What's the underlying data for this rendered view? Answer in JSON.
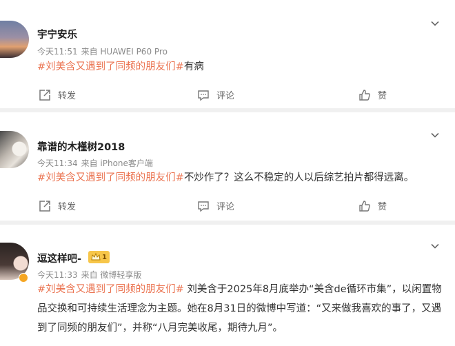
{
  "posts": [
    {
      "username": "宇宁安乐",
      "time": "今天11:51",
      "source": "来自 HUAWEI P60 Pro",
      "hashtag": "#刘美含又遇到了同频的朋友们#",
      "text": "有病",
      "actions": {
        "repost": "转发",
        "comment": "评论",
        "like": "赞"
      }
    },
    {
      "username": "靠谱的木槿树2018",
      "time": "今天11:34",
      "source": "来自 iPhone客户端",
      "hashtag": "#刘美含又遇到了同频的朋友们#",
      "text": "不炒作了？这么不稳定的人以后综艺拍片都得远离。",
      "actions": {
        "repost": "转发",
        "comment": "评论",
        "like": "赞"
      }
    },
    {
      "username": "逗这样吧-",
      "badge": "1",
      "time": "今天11:33",
      "source": "来自 微博轻享版",
      "hashtag": "#刘美含又遇到了同频的朋友们#",
      "text": " 刘美含于2025年8月底举办“美含de循环市集”，以闲置物品交换和可持续生活理念为主题。她在8月31日的微博中写道：“又来做我喜欢的事了，又遇到了同频的朋友们”，并称“八月完美收尾，期待九月”。"
    }
  ],
  "colors": {
    "hashtag": "#eb7350",
    "meta": "#8a8a8a",
    "badge": "#f7c64a"
  }
}
